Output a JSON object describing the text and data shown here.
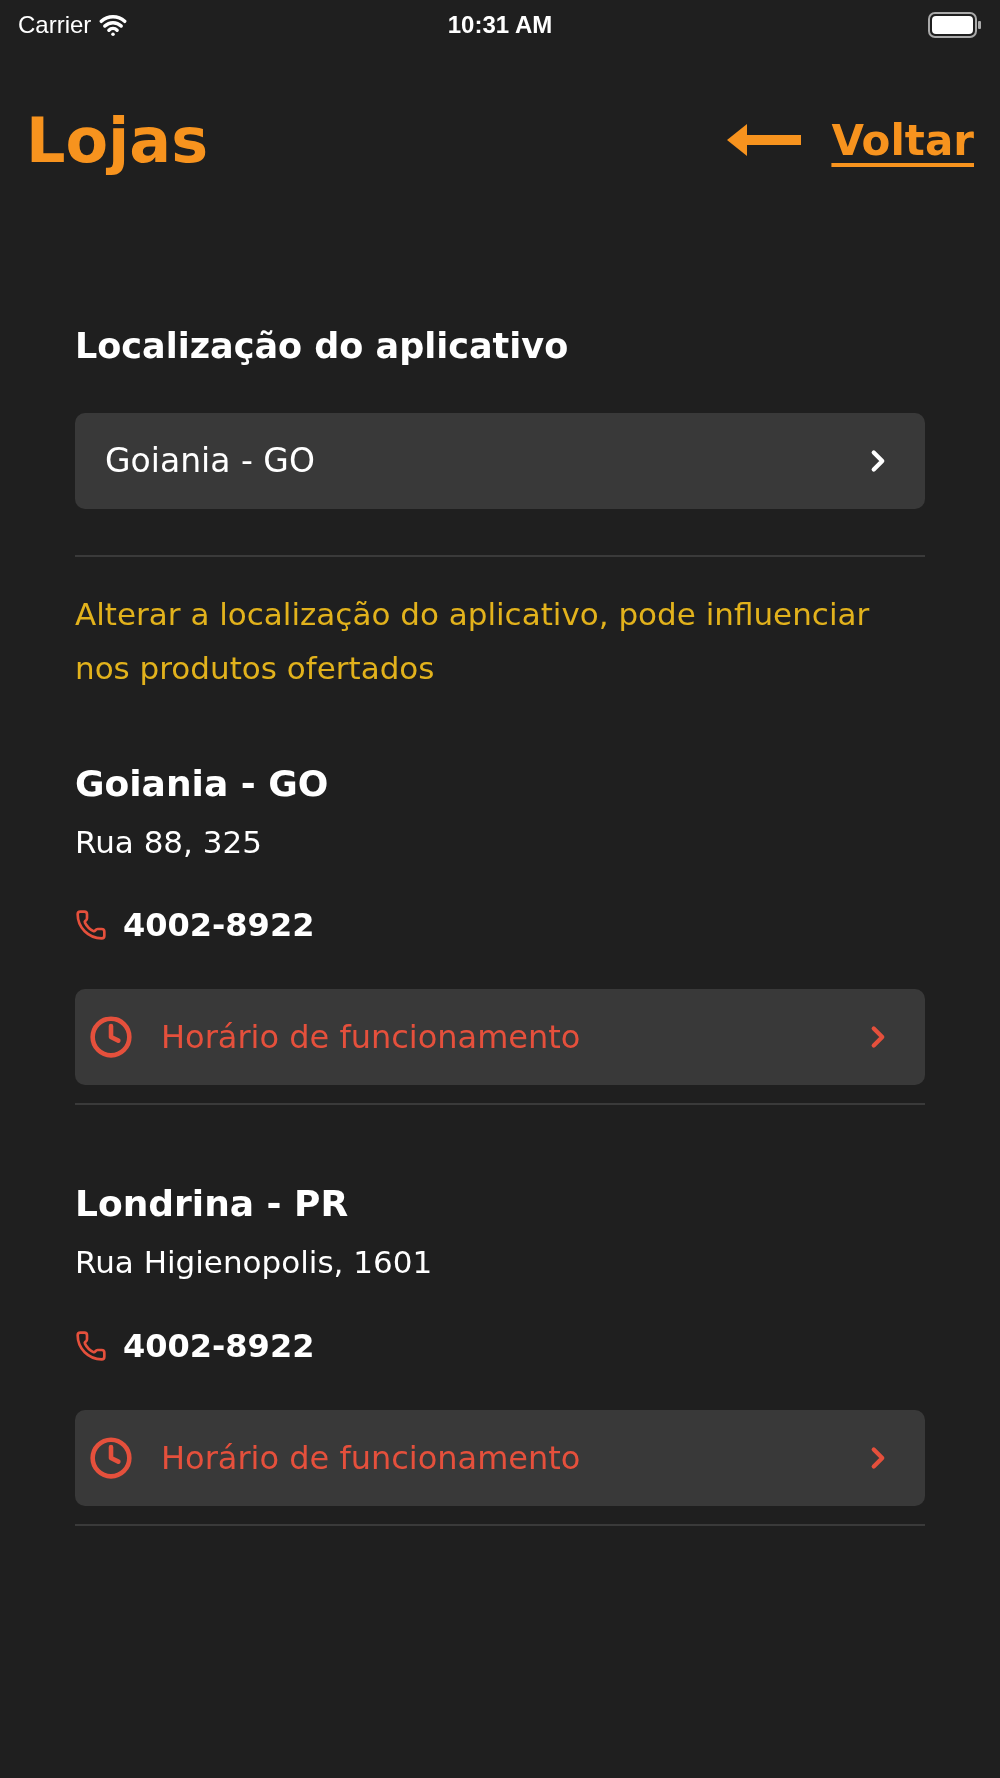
{
  "status_bar": {
    "carrier": "Carrier",
    "time": "10:31 AM"
  },
  "header": {
    "title": "Lojas",
    "back_label": "Voltar"
  },
  "location": {
    "label": "Localização do aplicativo",
    "value": "Goiania - GO"
  },
  "notice": "Alterar a localização do aplicativo, pode influenciar nos produtos ofertados",
  "stores": [
    {
      "name": "Goiania - GO",
      "address": "Rua 88, 325",
      "phone": "4002-8922",
      "hours_label": "Horário de funcionamento"
    },
    {
      "name": "Londrina - PR",
      "address": "Rua Higienopolis, 1601",
      "phone": "4002-8922",
      "hours_label": "Horário de funcionamento"
    }
  ]
}
